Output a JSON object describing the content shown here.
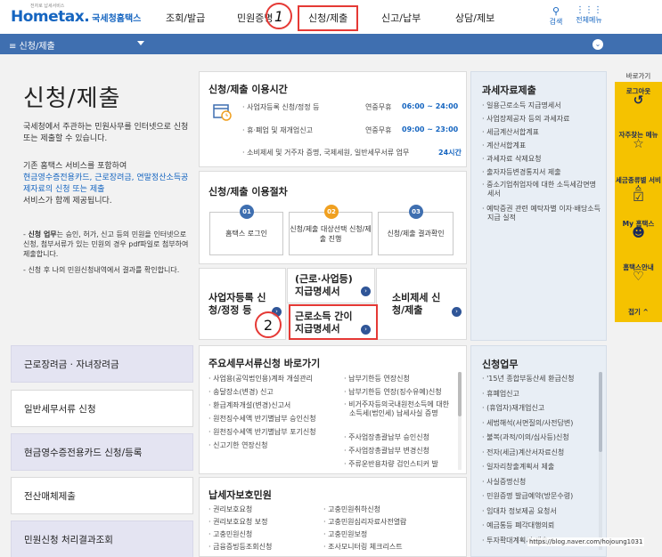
{
  "header": {
    "logo_main": "Hometax.",
    "logo_sub": "국세청홈택스",
    "logo_tiny": "전자로 납세서비스",
    "menu": [
      "조회/발급",
      "민원증명",
      "신청/제출",
      "신고/납부",
      "상담/제보"
    ],
    "annotation1": "1",
    "search_label": "검색",
    "allmenu_label": "전체메뉴"
  },
  "navbar": {
    "current": "≡  신청/제출"
  },
  "intro": {
    "title": "신청/제출",
    "p1": "국세청에서 주관하는 민원사무를 인터넷으로 신청 또는 제출할 수 있습니다.",
    "p2_a": "기존 홈택스 서비스를 포함하여",
    "p2_b": "현금영수증전용카드, 근로장려금, 연말정산소득공제자료의 신청 또는 제출",
    "p2_c": "서비스가 함께 제공됩니다.",
    "note1_bold": "신청 업무",
    "note1_rest": "는 승인, 허가, 신고 등의 민원을 인터넷으로 신청, 첨부서류가 있는 민원의 경우 pdf파일로 첨부하여 제출합니다.",
    "note2": "신청 후 나의 민원신청내역에서 결과를 확인합니다."
  },
  "left_menu": [
    "근로장려금 · 자녀장려금",
    "일반세무서류 신청",
    "현금영수증전용카드 신청/등록",
    "전산매체제출",
    "민원신청 처리결과조회"
  ],
  "hours": {
    "title": "신청/제출 이용시간",
    "rows": [
      {
        "label": "사업자등록 신청/정정 등",
        "days": "연중무휴",
        "time": "06:00 ~ 24:00"
      },
      {
        "label": "휴·폐업 및 재개업신고",
        "days": "연중무휴",
        "time": "09:00 ~ 23:00"
      },
      {
        "label": "소비제세 및 거주자 증명, 국제세원, 일반세무서류 업무",
        "days": "",
        "time": "24시간"
      }
    ]
  },
  "procedure": {
    "title": "신청/제출 이용절차",
    "steps": [
      {
        "num": "01",
        "label": "홈택스 로그인"
      },
      {
        "num": "02",
        "label": "신청/제출 대상선택 신청/제출 진행"
      },
      {
        "num": "03",
        "label": "신청/제출 결과확인"
      }
    ]
  },
  "shortcuts": {
    "biz_reg": "사업자등록 신청/정정 등",
    "pay_stmt": "(근로·사업등) 지급명세서",
    "consumption": "소비제세 신청/제출",
    "simple_stmt": "근로소득 간이지급명세서",
    "annotation2": "2"
  },
  "docs": {
    "title": "주요세무서류신청 바로가기",
    "col1": [
      "사업용(공익법인용)계좌 개설관리",
      "송달장소(변경) 신고",
      "환급계좌개설(변경)신고서",
      "원천징수세액 반기별납부 승인신청",
      "원천징수세액 반기별납부 포기신청",
      "신고기한 연장신청"
    ],
    "col2": [
      "납부기한등 연장신청",
      "납부기한등 연장(징수유예)신청",
      "비거주자등의국내원천소득에 대한 소득세(법인세) 납세사실 증명",
      "주사업장총괄납부 승인신청",
      "주사업장총괄납부 변경신청",
      "주류운반용차량 검인스티커 발"
    ]
  },
  "protect": {
    "title": "납세자보호민원",
    "col1": [
      "권리보호요청",
      "권리보호요청 보정",
      "고충민원신청",
      "금융증빙등조회신청"
    ],
    "col2": [
      "고충민원취하신청",
      "고충민원심리자료사전열람",
      "고충민원보정",
      "조사모니터링 체크리스트"
    ]
  },
  "tax_data": {
    "title": "과세자료제출",
    "items": [
      "일용근로소득 지급명세서",
      "사업장제공자 등의 과세자료",
      "세금계산서합계표",
      "계산서합계표",
      "과세자료 삭제요청",
      "출자자등변경통지서 제출",
      "중소기업취업자에 대한 소득세감면명세서",
      "예탁증권 관련 예탁자별 이자·배당소득 지급 실적"
    ]
  },
  "apply_work": {
    "title": "신청업무",
    "items": [
      "'15년 종합부동산세 환급신청",
      "휴폐업신고",
      "(휴업자)재개업신고",
      "세법해석(서면질의/사전답변)",
      "불복(과적/이의/심사등)신청",
      "전자(세금)계산서자료신청",
      "일자리창출계획서 제출",
      "사실증명신청",
      "민원증명 발급예약(방문수령)",
      "임대차 정보제공 요청서",
      "예금통등 폐각대행의뢰",
      "투자확대계획서 제출"
    ]
  },
  "quick": {
    "title": "바로가기",
    "items": [
      "로그아웃",
      "자주찾는 메뉴",
      "세금종류별 서비스",
      "My 홈택스",
      "홈택스안내"
    ],
    "top": "접기 ^"
  },
  "watermark": "https://blog.naver.com/hojoung1031"
}
